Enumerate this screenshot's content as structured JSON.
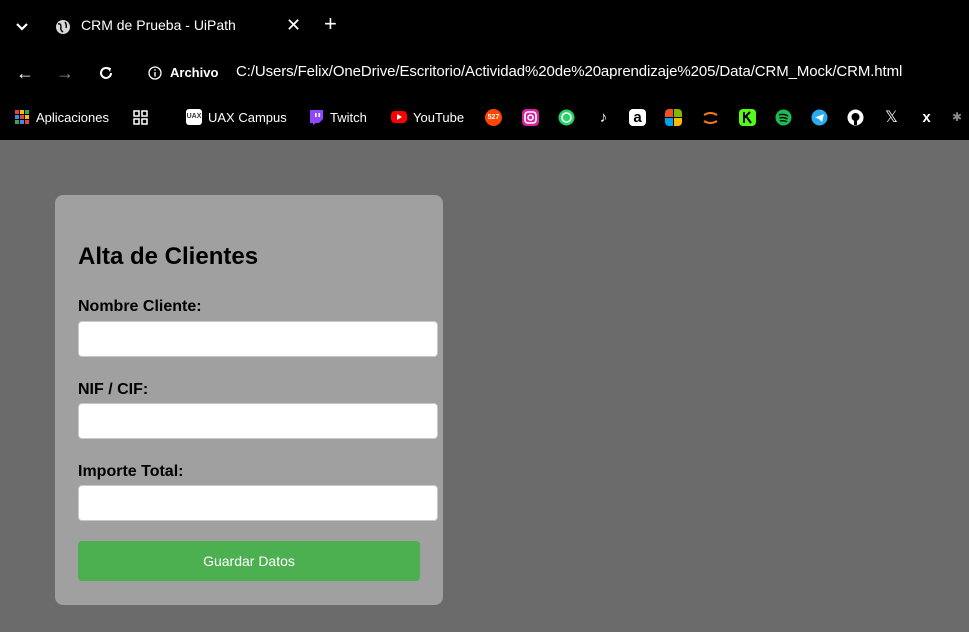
{
  "browser": {
    "tab_title": "CRM de Prueba - UiPath",
    "tab_close": "✕",
    "new_tab": "+",
    "address_label": "Archivo",
    "url": "C:/Users/Felix/OneDrive/Escritorio/Actividad%20de%20aprendizaje%205/Data/CRM_Mock/CRM.html"
  },
  "bookmarks": {
    "apps": "Aplicaciones",
    "uax": "UAX Campus",
    "twitch": "Twitch",
    "youtube": "YouTube",
    "uax_badge": "UAX",
    "reddit_badge": "527"
  },
  "form": {
    "title": "Alta de Clientes",
    "name_label": "Nombre Cliente:",
    "nif_label": "NIF / CIF:",
    "amount_label": "Importe Total:",
    "name_value": "",
    "nif_value": "",
    "amount_value": "",
    "save_label": "Guardar Datos"
  },
  "colors": {
    "page_bg": "#6b6b6b",
    "card_bg": "#a0a0a0",
    "button": "#4caf50"
  }
}
